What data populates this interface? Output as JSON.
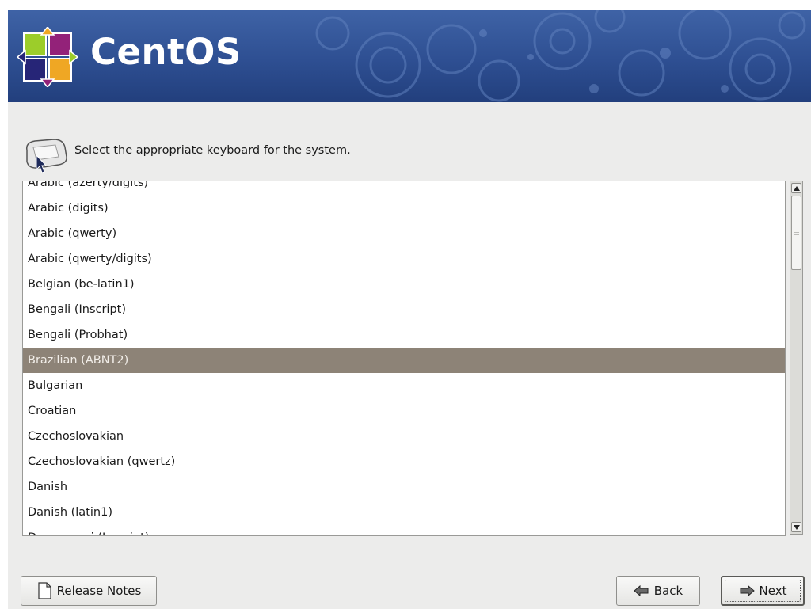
{
  "banner": {
    "brand": "CentOS"
  },
  "prompt": {
    "text": "Select the appropriate keyboard for the system."
  },
  "keyboard_list": {
    "selected": "Brazilian (ABNT2)",
    "items": [
      "Arabic (azerty/digits)",
      "Arabic (digits)",
      "Arabic (qwerty)",
      "Arabic (qwerty/digits)",
      "Belgian (be-latin1)",
      "Bengali (Inscript)",
      "Bengali (Probhat)",
      "Brazilian (ABNT2)",
      "Bulgarian",
      "Croatian",
      "Czechoslovakian",
      "Czechoslovakian (qwertz)",
      "Danish",
      "Danish (latin1)",
      "Devanagari (Inscript)"
    ]
  },
  "buttons": {
    "release_notes": {
      "mnemonic": "R",
      "rest": "elease Notes"
    },
    "back": {
      "mnemonic": "B",
      "rest": "ack"
    },
    "next": {
      "mnemonic": "N",
      "rest": "ext"
    }
  },
  "colors": {
    "banner": "#2e4f92",
    "selection": "#8d8377",
    "window_bg": "#ececeb"
  }
}
